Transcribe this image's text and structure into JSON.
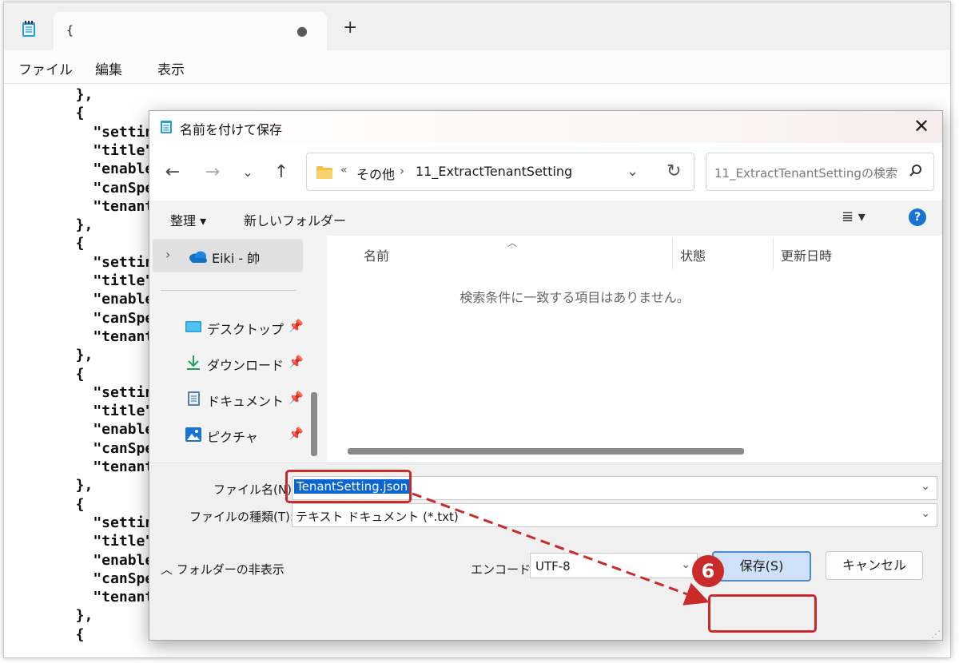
{
  "notepad": {
    "tab_title": "{",
    "new_tab": "+",
    "menu": {
      "file": "ファイル",
      "edit": "編集",
      "view": "表示"
    },
    "code_lines": [
      "},",
      "{",
      "  \"settingN",
      "  \"title\":",
      "  \"enabled\"",
      "  \"canSpeci",
      "  \"tenantSe",
      "},",
      "{",
      "  \"settingN",
      "  \"title\":",
      "  \"enabled\"",
      "  \"canSpeci",
      "  \"tenantSe",
      "},",
      "{",
      "  \"settingN",
      "  \"title\":",
      "  \"enabled\"",
      "  \"canSpeci",
      "  \"tenantSe",
      "},",
      "{",
      "  \"settingN",
      "  \"title\":",
      "  \"enabled\"",
      "  \"canSpeci",
      "  \"tenantSe",
      "},",
      "{"
    ]
  },
  "dialog": {
    "title": "名前を付けて保存",
    "address": {
      "overflow": "«",
      "crumb1": "その他",
      "separator": "›",
      "crumb2": "11_ExtractTenantSetting"
    },
    "search_placeholder": "11_ExtractTenantSettingの検索",
    "commands": {
      "organize": "整理 ▾",
      "new_folder": "新しいフォルダー",
      "view": "≣ ▾",
      "help": "?"
    },
    "nav": {
      "onedrive": "Eiki - 帥",
      "items": [
        {
          "label": "デスクトップ",
          "icon": "desktop-icon"
        },
        {
          "label": "ダウンロード",
          "icon": "download-icon"
        },
        {
          "label": "ドキュメント",
          "icon": "documents-icon"
        },
        {
          "label": "ピクチャ",
          "icon": "pictures-icon"
        }
      ]
    },
    "columns": {
      "name": "名前",
      "status": "状態",
      "modified": "更新日時"
    },
    "empty_message": "検索条件に一致する項目はありません。",
    "form": {
      "filename_label": "ファイル名(N):",
      "filename_value": "TenantSetting.json",
      "filetype_label": "ファイルの種類(T):",
      "filetype_value": "テキスト ドキュメント (*.txt)",
      "toggle_folders": "フォルダーの非表示",
      "encode_label": "エンコード:",
      "encode_value": "UTF-8",
      "save_button": "保存(S)",
      "cancel_button": "キャンセル"
    }
  },
  "annotation": {
    "step_number": "6",
    "color": "#c92b2b"
  }
}
